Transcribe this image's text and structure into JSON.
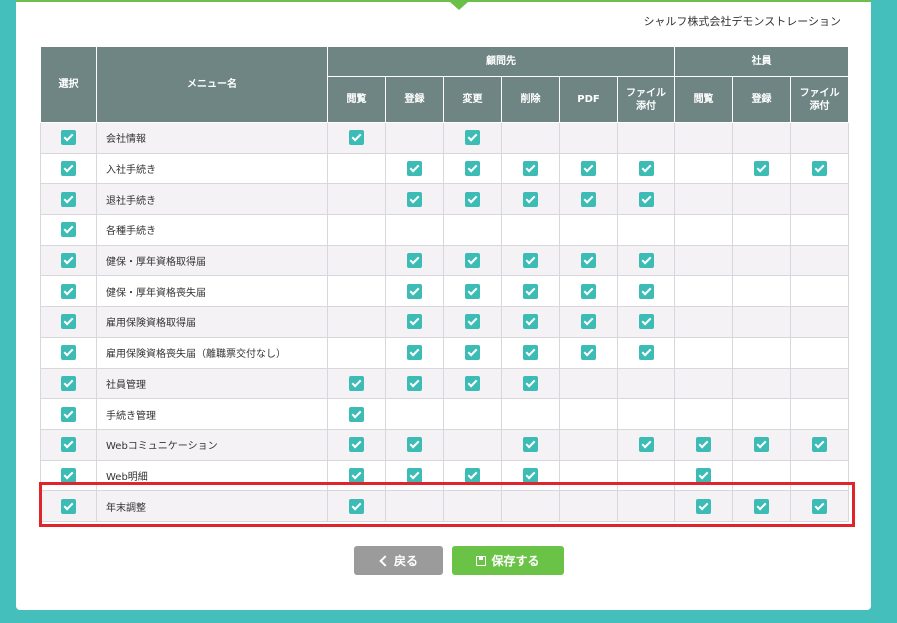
{
  "company_name": "シャルフ株式会社デモンストレーション",
  "headers": {
    "select": "選択",
    "menu_name": "メニュー名",
    "group_advisor": "顧問先",
    "group_employee": "社員",
    "view": "閲覧",
    "register": "登録",
    "change": "変更",
    "delete": "削除",
    "pdf": "PDF",
    "file_attach": "ファイル添付"
  },
  "rows": [
    {
      "name": "会社情報",
      "checks": [
        1,
        1,
        0,
        1,
        0,
        0,
        0,
        0,
        0,
        0
      ]
    },
    {
      "name": "入社手続き",
      "checks": [
        1,
        0,
        1,
        1,
        1,
        1,
        1,
        0,
        1,
        1
      ]
    },
    {
      "name": "退社手続き",
      "checks": [
        1,
        0,
        1,
        1,
        1,
        1,
        1,
        0,
        0,
        0
      ]
    },
    {
      "name": "各種手続き",
      "checks": [
        1,
        0,
        0,
        0,
        0,
        0,
        0,
        0,
        0,
        0
      ]
    },
    {
      "name": "健保・厚年資格取得届",
      "checks": [
        1,
        0,
        1,
        1,
        1,
        1,
        1,
        0,
        0,
        0
      ]
    },
    {
      "name": "健保・厚年資格喪失届",
      "checks": [
        1,
        0,
        1,
        1,
        1,
        1,
        1,
        0,
        0,
        0
      ]
    },
    {
      "name": "雇用保険資格取得届",
      "checks": [
        1,
        0,
        1,
        1,
        1,
        1,
        1,
        0,
        0,
        0
      ]
    },
    {
      "name": "雇用保険資格喪失届（離職票交付なし）",
      "checks": [
        1,
        0,
        1,
        1,
        1,
        1,
        1,
        0,
        0,
        0
      ]
    },
    {
      "name": "社員管理",
      "checks": [
        1,
        1,
        1,
        1,
        1,
        0,
        0,
        0,
        0,
        0
      ]
    },
    {
      "name": "手続き管理",
      "checks": [
        1,
        1,
        0,
        0,
        0,
        0,
        0,
        0,
        0,
        0
      ]
    },
    {
      "name": "Webコミュニケーション",
      "checks": [
        1,
        1,
        1,
        0,
        1,
        0,
        1,
        1,
        1,
        1
      ]
    },
    {
      "name": "Web明細",
      "checks": [
        1,
        1,
        1,
        1,
        1,
        0,
        0,
        1,
        0,
        0
      ]
    },
    {
      "name": "年末調整",
      "checks": [
        1,
        1,
        0,
        0,
        0,
        0,
        0,
        1,
        1,
        1
      ]
    }
  ],
  "buttons": {
    "back_label": "戻る",
    "save_label": "保存する"
  },
  "colors": {
    "background": "#45bfbb",
    "header_bg": "#6e8584",
    "checkbox": "#3dbcb5",
    "save_button": "#6ac346",
    "back_button": "#9b9b9b",
    "highlight": "#e0242c"
  }
}
